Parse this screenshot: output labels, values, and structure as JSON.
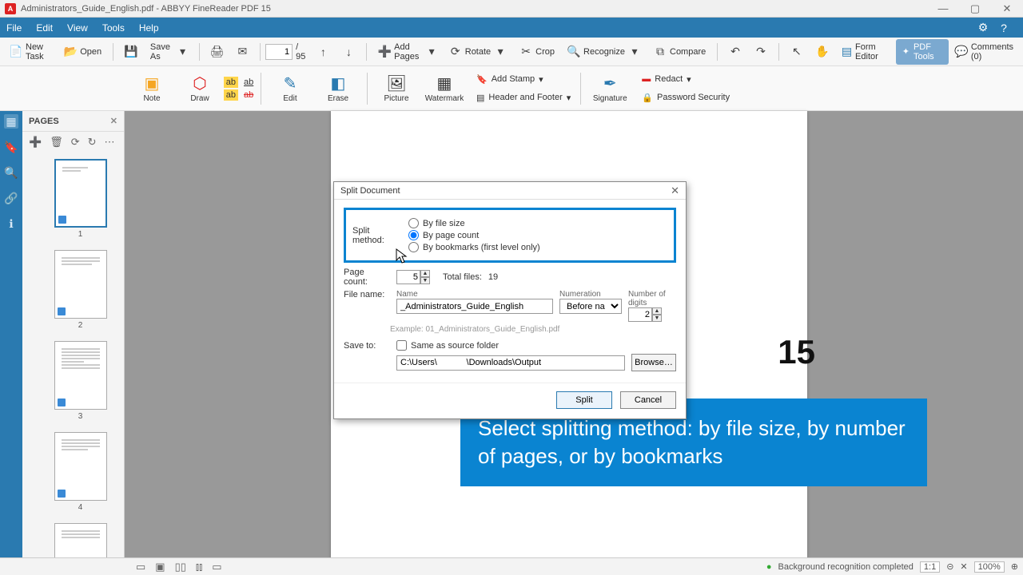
{
  "title": "Administrators_Guide_English.pdf - ABBYY FineReader PDF 15",
  "menu": {
    "file": "File",
    "edit": "Edit",
    "view": "View",
    "tools": "Tools",
    "help": "Help"
  },
  "toolbar": {
    "newtask": "New Task",
    "open": "Open",
    "saveas": "Save As",
    "page_current": "1",
    "page_total": "/ 95",
    "addpages": "Add Pages",
    "rotate": "Rotate",
    "crop": "Crop",
    "recognize": "Recognize",
    "compare": "Compare",
    "formeditor": "Form Editor",
    "pdftools": "PDF Tools",
    "comments": "Comments (0)"
  },
  "toolbar2": {
    "note": "Note",
    "draw": "Draw",
    "edit": "Edit",
    "erase": "Erase",
    "picture": "Picture",
    "watermark": "Watermark",
    "addstamp": "Add Stamp",
    "headerfooter": "Header and Footer",
    "signature": "Signature",
    "redact": "Redact",
    "security": "Password Security"
  },
  "pages_panel": {
    "title": "PAGES",
    "thumb_count": 5
  },
  "dialog": {
    "title": "Split Document",
    "split_method_label": "Split method:",
    "opt_filesize": "By file size",
    "opt_pagecount": "By page count",
    "opt_bookmarks": "By bookmarks (first level only)",
    "selected": "pagecount",
    "pagecount_label": "Page count:",
    "pagecount_value": "5",
    "total_files_label": "Total files:",
    "total_files_value": "19",
    "filename_label": "File name:",
    "name_label": "Name",
    "name_value": "_Administrators_Guide_English",
    "example": "Example: 01_Administrators_Guide_English.pdf",
    "numeration_label": "Numeration",
    "numeration_value": "Before name",
    "digits_label": "Number of digits",
    "digits_value": "2",
    "saveto_label": "Save to:",
    "same_source": "Same as source folder",
    "path_value": "C:\\Users\\            \\Downloads\\Output",
    "browse": "Browse…",
    "split": "Split",
    "cancel": "Cancel"
  },
  "big_number": "15",
  "tip": "Select splitting method: by file size, by number of pages, or by bookmarks",
  "status": {
    "msg": "Background recognition completed",
    "fit": "1:1",
    "zoom": "100%"
  }
}
